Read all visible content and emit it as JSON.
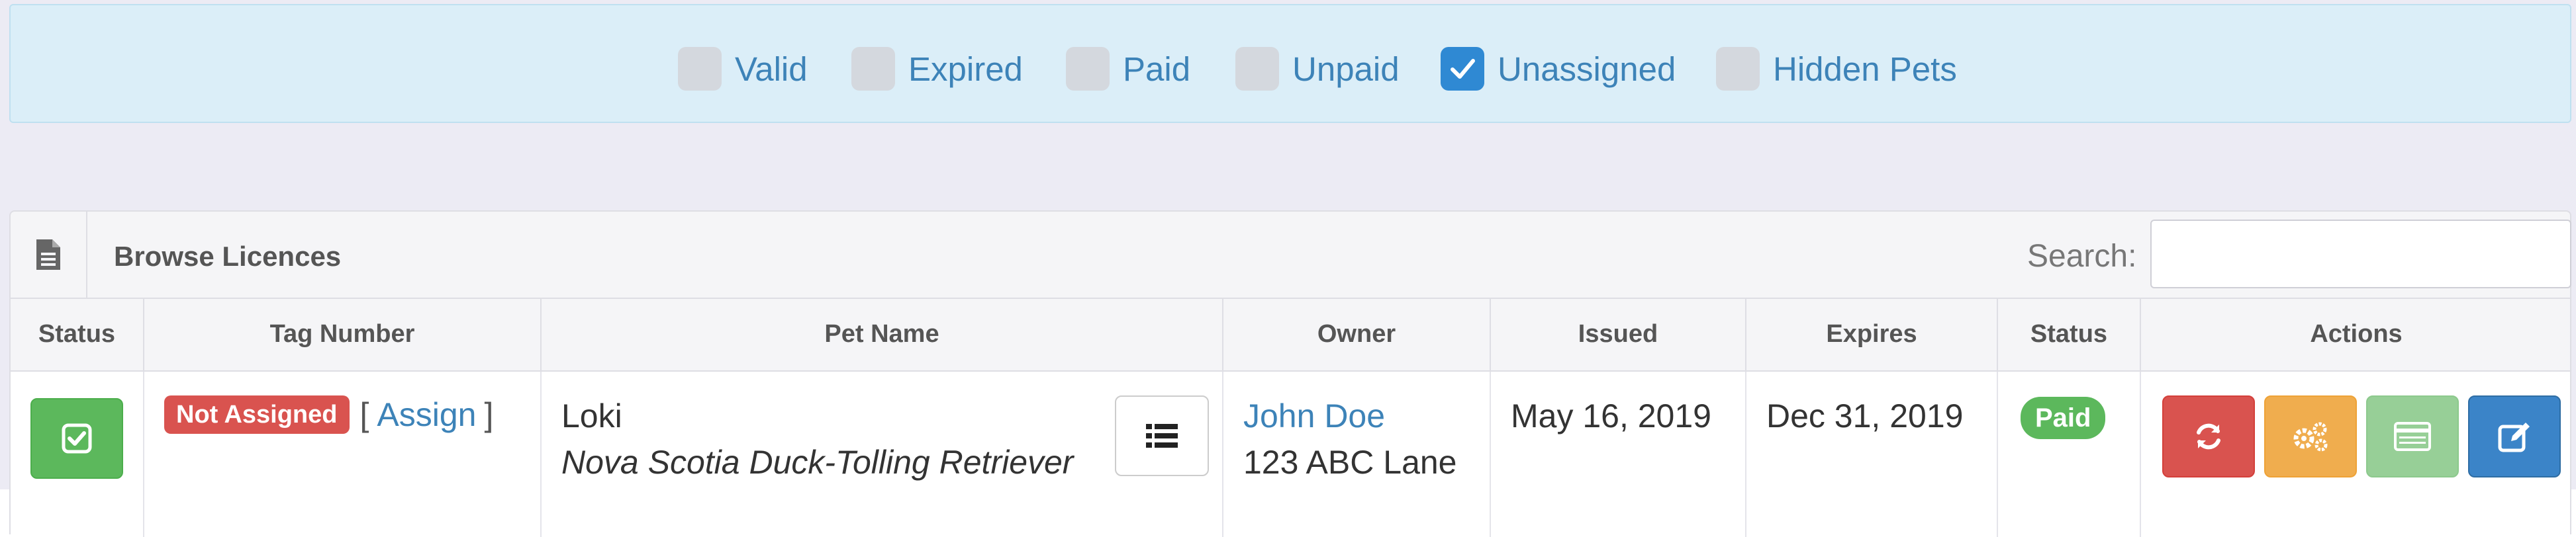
{
  "filters": [
    {
      "label": "Valid",
      "checked": false
    },
    {
      "label": "Expired",
      "checked": false
    },
    {
      "label": "Paid",
      "checked": false
    },
    {
      "label": "Unpaid",
      "checked": false
    },
    {
      "label": "Unassigned",
      "checked": true
    },
    {
      "label": "Hidden Pets",
      "checked": false
    }
  ],
  "panel": {
    "icon": "document-icon",
    "title": "Browse Licences",
    "search_label": "Search:",
    "search_value": ""
  },
  "table": {
    "columns": [
      "Status",
      "Tag Number",
      "Pet Name",
      "Owner",
      "Issued",
      "Expires",
      "Status",
      "Actions"
    ],
    "rows": [
      {
        "status_icon": "check-square-icon",
        "tag_badge": "Not Assigned",
        "bracket_open": "[",
        "assign_link": "Assign",
        "bracket_close": "]",
        "pet_name": "Loki",
        "pet_breed": "Nova Scotia Duck-Tolling Retriever",
        "owner_name": "John Doe",
        "owner_address": "123 ABC Lane",
        "issued": "May 16, 2019",
        "expires": "Dec 31, 2019",
        "payment_status": "Paid",
        "actions": [
          "refresh-icon",
          "gears-icon",
          "card-icon",
          "edit-icon"
        ]
      }
    ]
  },
  "colors": {
    "green": "#5cb85c",
    "red": "#d9534f",
    "orange": "#f0ad4e",
    "light_green": "#97cf97",
    "blue": "#3b84c8",
    "link": "#3d83b8"
  }
}
